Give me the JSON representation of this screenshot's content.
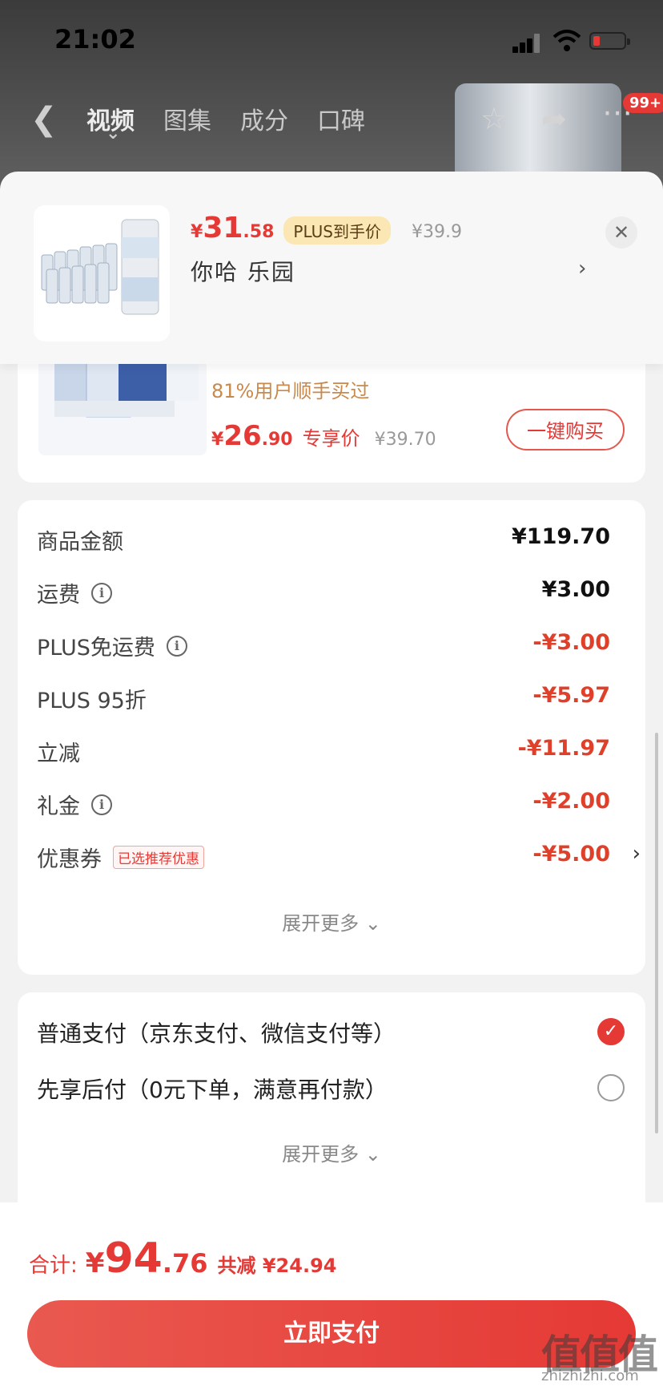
{
  "status_bar": {
    "time": "21:02"
  },
  "top_nav": {
    "tabs": [
      "视频",
      "图集",
      "成分",
      "口碑"
    ],
    "cart_badge": "99+"
  },
  "product": {
    "price_symbol": "¥",
    "price_int": "31",
    "price_dec": ".58",
    "plus_tag": "PLUS到手价",
    "original_price": "¥39.9",
    "variant": "你哈  乐园"
  },
  "recommend": {
    "bought_text": "81%用户顺手买过",
    "price_symbol": "¥",
    "price_int": "26",
    "price_dec": ".90",
    "exclusive": "专享价",
    "original_price": "¥39.70",
    "buy_button": "一键购买"
  },
  "amounts": {
    "rows": [
      {
        "label": "商品金额",
        "value": "¥119.70",
        "info": false,
        "red": false
      },
      {
        "label": "运费",
        "value": "¥3.00",
        "info": true,
        "red": false
      },
      {
        "label": "PLUS免运费",
        "value": "-¥3.00",
        "info": true,
        "red": true
      },
      {
        "label": "PLUS 95折",
        "value": "-¥5.97",
        "info": false,
        "red": true
      },
      {
        "label": "立减",
        "value": "-¥11.97",
        "info": false,
        "red": true
      },
      {
        "label": "礼金",
        "value": "-¥2.00",
        "info": true,
        "red": true
      },
      {
        "label": "优惠券",
        "value": "-¥5.00",
        "info": false,
        "red": true
      }
    ],
    "coupon_tag": "已选推荐优惠",
    "expand": "展开更多"
  },
  "payment": {
    "options": [
      {
        "label": "普通支付（京东支付、微信支付等）",
        "selected": true
      },
      {
        "label": "先享后付（0元下单，满意再付款）",
        "selected": false
      }
    ],
    "expand": "展开更多"
  },
  "footer": {
    "total_label": "合计:",
    "total_symbol": "¥",
    "total_int": "94",
    "total_dec": ".76",
    "saved": "共减 ¥24.94",
    "pay_button": "立即支付"
  },
  "watermark": {
    "logo": "值值值",
    "site": "zhizhizhi.com"
  },
  "colors": {
    "accent": "#e53935",
    "plus_tag_bg": "#fbe7b4",
    "bought_text": "#c9894a"
  }
}
